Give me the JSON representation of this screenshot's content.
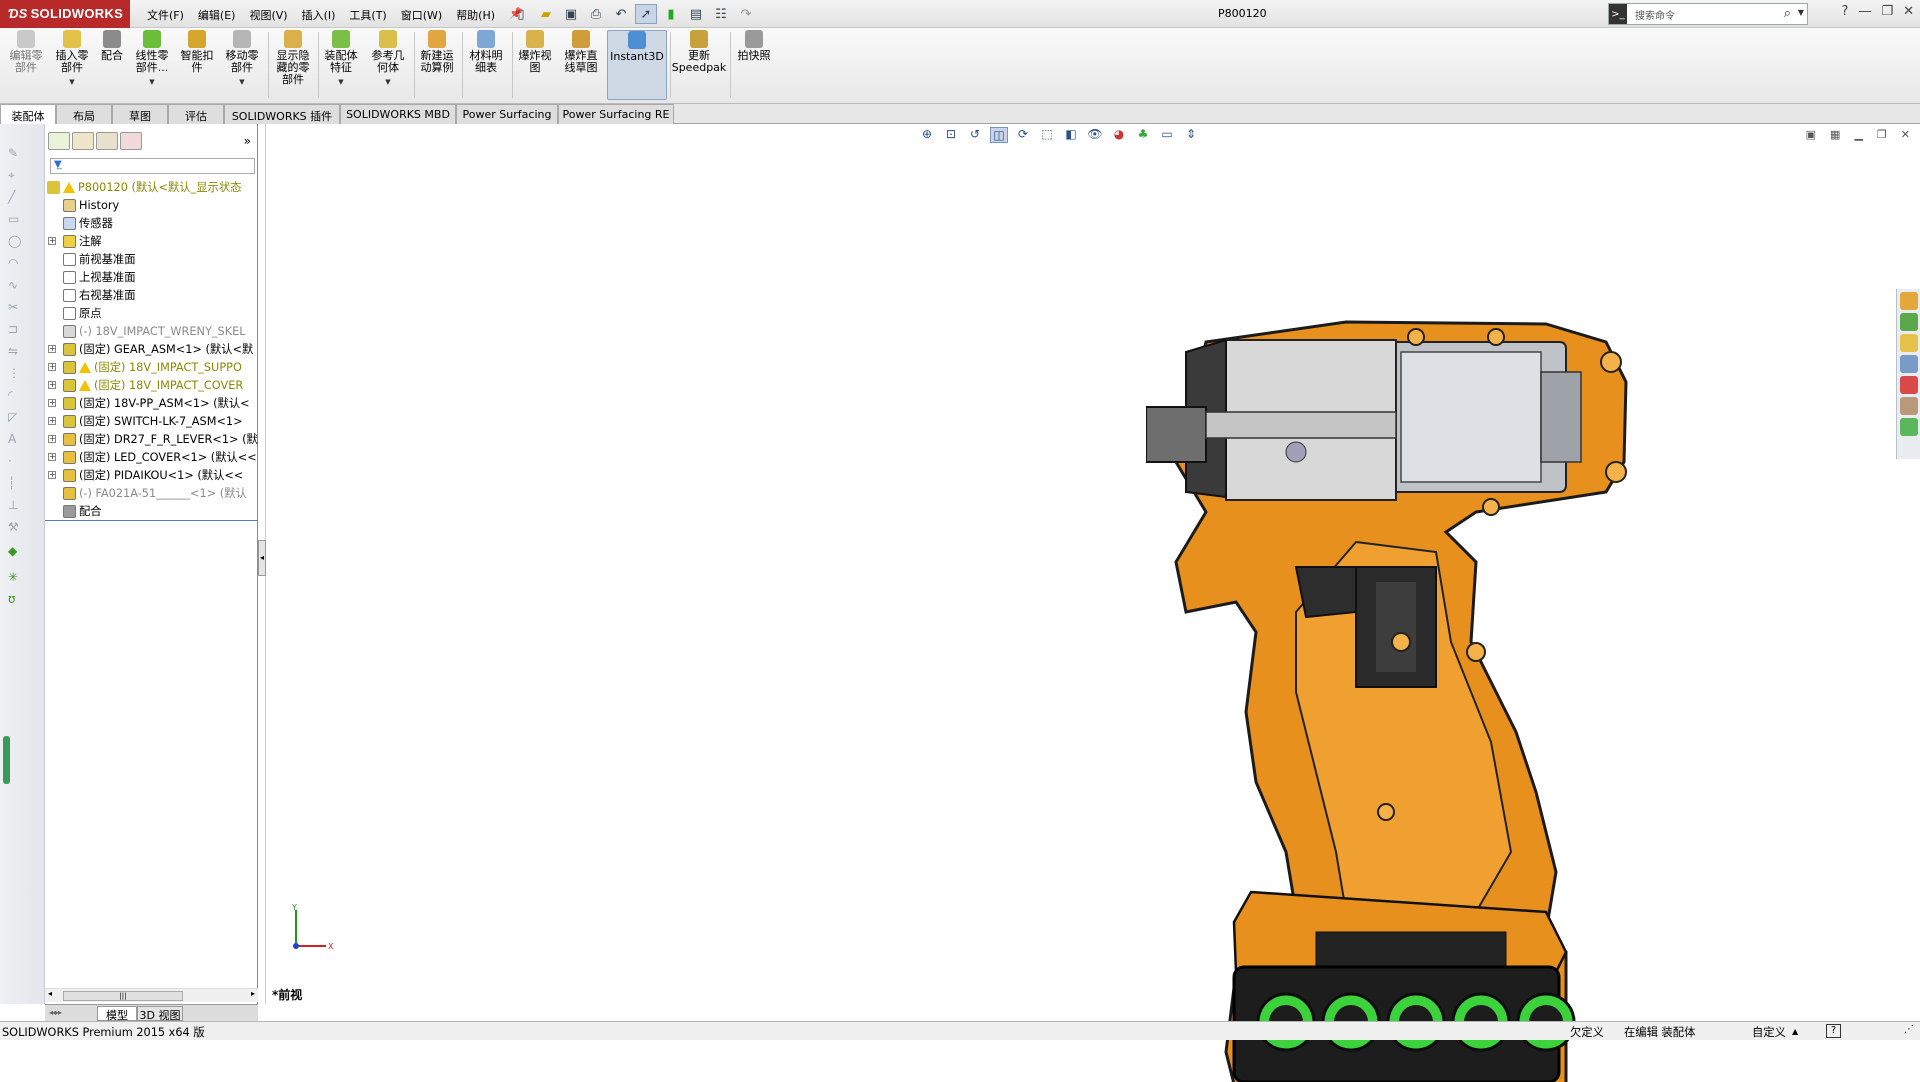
{
  "app": {
    "logo": "SOLIDWORKS",
    "doc_title": "P800120",
    "version": "SOLIDWORKS Premium 2015 x64 版"
  },
  "menu": [
    "文件(F)",
    "编辑(E)",
    "视图(V)",
    "插入(I)",
    "工具(T)",
    "窗口(W)",
    "帮助(H)"
  ],
  "search": {
    "placeholder": "搜索命令"
  },
  "ribbon": {
    "edit_component": "编辑零\n部件",
    "insert_component": "插入零\n部件",
    "mate": "配合",
    "linear_pattern": "线性零\n部件...",
    "smart_fasteners": "智能扣\n件",
    "move_component": "移动零\n部件",
    "show_hidden": "显示隐\n藏的零\n部件",
    "assembly_features": "装配体\n特征",
    "reference_geometry": "参考几\n何体",
    "new_motion_study": "新建运\n动算例",
    "bom": "材料明\n细表",
    "exploded_view": "爆炸视\n图",
    "explode_line": "爆炸直\n线草图",
    "instant3d": "Instant3D",
    "update_speedpak": "更新\nSpeedpak",
    "snapshot": "拍快照"
  },
  "tabs": [
    "装配体",
    "布局",
    "草图",
    "评估",
    "SOLIDWORKS 插件",
    "SOLIDWORKS MBD",
    "Power Surfacing",
    "Power Surfacing RE"
  ],
  "tree": {
    "root": "P800120  (默认<默认_显示状态",
    "items": [
      {
        "label": "History",
        "style": "normal",
        "icon": "history-icon",
        "expand": false
      },
      {
        "label": "传感器",
        "style": "normal",
        "icon": "sensor-icon",
        "expand": false
      },
      {
        "label": "注解",
        "style": "normal",
        "icon": "annotation-icon",
        "expand": true
      },
      {
        "label": "前视基准面",
        "style": "normal",
        "icon": "plane-icon",
        "expand": false
      },
      {
        "label": "上视基准面",
        "style": "normal",
        "icon": "plane-icon",
        "expand": false
      },
      {
        "label": "右视基准面",
        "style": "normal",
        "icon": "plane-icon",
        "expand": false
      },
      {
        "label": "原点",
        "style": "normal",
        "icon": "origin-icon",
        "expand": false
      },
      {
        "label": "(-) 18V_IMPACT_WRENY_SKEL",
        "style": "gray",
        "icon": "sketch-part-icon",
        "expand": false
      },
      {
        "label": "(固定) GEAR_ASM<1> (默认<默",
        "style": "normal",
        "icon": "assembly-icon",
        "expand": true
      },
      {
        "label": "(固定) 18V_IMPACT_SUPPO",
        "style": "olive",
        "icon": "assembly-warning-icon",
        "expand": true
      },
      {
        "label": "(固定) 18V_IMPACT_COVER",
        "style": "olive",
        "icon": "assembly-warning-icon",
        "expand": true
      },
      {
        "label": "(固定) 18V-PP_ASM<1> (默认<",
        "style": "normal",
        "icon": "assembly-icon",
        "expand": true
      },
      {
        "label": "(固定) SWITCH-LK-7_ASM<1>",
        "style": "normal",
        "icon": "assembly-icon",
        "expand": true
      },
      {
        "label": "(固定) DR27_F_R_LEVER<1> (默",
        "style": "normal",
        "icon": "part-icon",
        "expand": true
      },
      {
        "label": "(固定) LED_COVER<1> (默认<<",
        "style": "normal",
        "icon": "part-icon",
        "expand": true
      },
      {
        "label": "(固定) PIDAIKOU<1> (默认<<",
        "style": "normal",
        "icon": "part-icon",
        "expand": true
      },
      {
        "label": "(-) FA021A-51______<1> (默认",
        "style": "gray",
        "icon": "part-icon",
        "expand": false
      },
      {
        "label": "配合",
        "style": "normal",
        "icon": "mates-icon",
        "expand": false
      }
    ]
  },
  "bottom_tabs": [
    "模型",
    "3D 视图"
  ],
  "view_label": "*前视",
  "status": {
    "under_defined": "欠定义",
    "editing": "在编辑 装配体",
    "custom": "自定义"
  },
  "colors": {
    "logo_red": "#b8292a",
    "housing_orange": "#e8901e",
    "battery_green": "#3bd23b",
    "selection_blue": "#c9d5e6"
  }
}
